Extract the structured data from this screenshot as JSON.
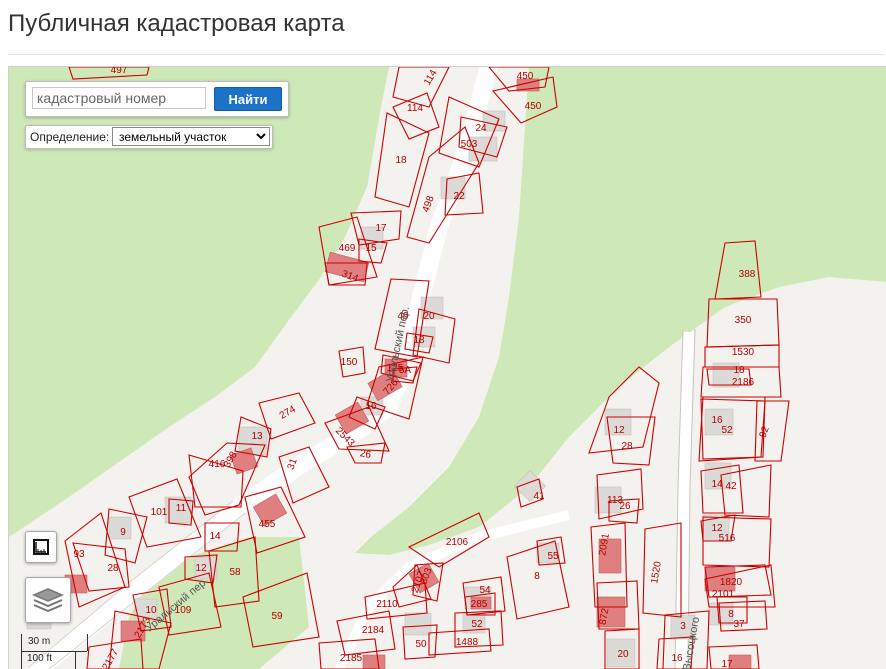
{
  "page": {
    "title": "Публичная кадастровая карта"
  },
  "search": {
    "placeholder": "кадастровый номер",
    "button_label": "Найти"
  },
  "definition": {
    "label": "Определение:",
    "selected": "земельный участок"
  },
  "controls": {
    "ruler_icon": "ruler-icon",
    "layers_icon": "layers-icon"
  },
  "scale": {
    "metric": "30 m",
    "imperial": "100 ft"
  },
  "colors": {
    "parcel_border": "#cc0000",
    "parcel_label": "#b30000",
    "building": "#e07f7f",
    "building_gray": "#dcdad6",
    "green": "#cfe8b8",
    "land": "#f4f2ee",
    "road": "#ffffff",
    "button_blue": "#1a73c8"
  },
  "map": {
    "parcels": [
      "497",
      "114",
      "450",
      "450",
      "114",
      "18",
      "503",
      "24",
      "498",
      "22",
      "17",
      "469",
      "15",
      "314",
      "49",
      "20",
      "18",
      "150",
      "125",
      "5А",
      "726",
      "274",
      "16",
      "13",
      "2543",
      "26",
      "398",
      "416",
      "31",
      "101",
      "11",
      "455",
      "93",
      "28",
      "9",
      "12",
      "14",
      "58",
      "109",
      "10",
      "59",
      "2173",
      "2177",
      "2106",
      "55",
      "2107",
      "803",
      "8",
      "54",
      "285",
      "2110",
      "2184",
      "52",
      "1488",
      "2185",
      "50",
      "41",
      "388",
      "350",
      "1530",
      "2186",
      "18",
      "16",
      "52",
      "92",
      "12",
      "28",
      "113",
      "26",
      "14",
      "42",
      "12",
      "516",
      "2091",
      "1520",
      "1820",
      "2101",
      "872",
      "37",
      "8",
      "3",
      "16",
      "17",
      "20"
    ],
    "streets": [
      "Уральский пер.",
      "Уральский пер.",
      "ул. Высоцкого"
    ]
  }
}
